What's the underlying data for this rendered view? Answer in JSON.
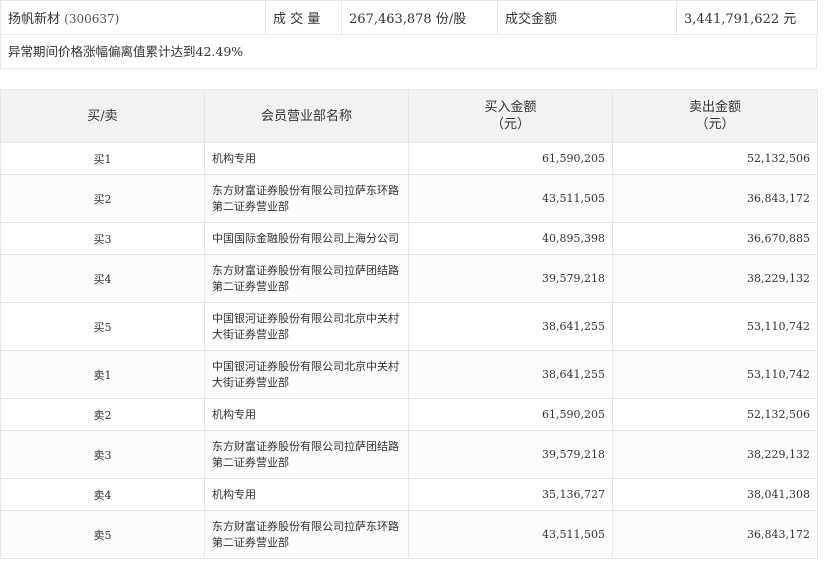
{
  "summary": {
    "stock_name": "扬帆新材",
    "stock_code": "(300637)",
    "volume_label": "成 交 量",
    "volume_value": "267,463,878 份/股",
    "amount_label": "成交金额",
    "amount_value": "3,441,791,622 元"
  },
  "note": "异常期间价格涨幅偏离值累计达到42.49%",
  "table": {
    "headers": {
      "side": "买/卖",
      "dept": "会员营业部名称",
      "buy": "买入金额",
      "buy_unit": "（元）",
      "sell": "卖出金额",
      "sell_unit": "（元）"
    },
    "rows": [
      {
        "side": "买1",
        "dept_line1": "机构专用",
        "dept_line2": "",
        "buy": "61,590,205",
        "sell": "52,132,506"
      },
      {
        "side": "买2",
        "dept_line1": "东方财富证券股份有限公司拉萨东环路",
        "dept_line2": "第二证券营业部",
        "buy": "43,511,505",
        "sell": "36,843,172"
      },
      {
        "side": "买3",
        "dept_line1": "中国国际金融股份有限公司上海分公司",
        "dept_line2": "",
        "buy": "40,895,398",
        "sell": "36,670,885"
      },
      {
        "side": "买4",
        "dept_line1": "东方财富证券股份有限公司拉萨团结路",
        "dept_line2": "第二证券营业部",
        "buy": "39,579,218",
        "sell": "38,229,132"
      },
      {
        "side": "买5",
        "dept_line1": "中国银河证券股份有限公司北京中关村",
        "dept_line2": "大街证券营业部",
        "buy": "38,641,255",
        "sell": "53,110,742"
      },
      {
        "side": "卖1",
        "dept_line1": "中国银河证券股份有限公司北京中关村",
        "dept_line2": "大街证券营业部",
        "buy": "38,641,255",
        "sell": "53,110,742"
      },
      {
        "side": "卖2",
        "dept_line1": "机构专用",
        "dept_line2": "",
        "buy": "61,590,205",
        "sell": "52,132,506"
      },
      {
        "side": "卖3",
        "dept_line1": "东方财富证券股份有限公司拉萨团结路",
        "dept_line2": "第二证券营业部",
        "buy": "39,579,218",
        "sell": "38,229,132"
      },
      {
        "side": "卖4",
        "dept_line1": "机构专用",
        "dept_line2": "",
        "buy": "35,136,727",
        "sell": "38,041,308"
      },
      {
        "side": "卖5",
        "dept_line1": "东方财富证券股份有限公司拉萨东环路",
        "dept_line2": "第二证券营业部",
        "buy": "43,511,505",
        "sell": "36,843,172"
      }
    ]
  }
}
